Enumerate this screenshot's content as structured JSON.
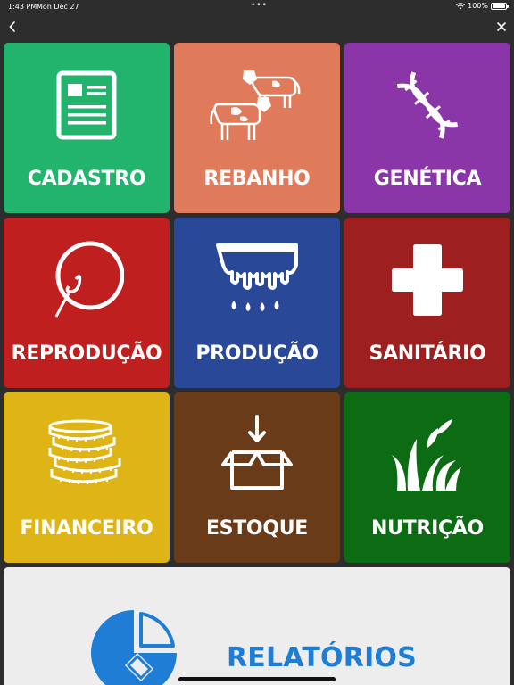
{
  "statusbar": {
    "time": "1:43 PM",
    "date": "Mon Dec 27",
    "dots": "•••",
    "battery": "100%"
  },
  "nav": {
    "back_icon": "chevron-left-icon",
    "close_icon": "close-icon"
  },
  "tiles": [
    {
      "label": "CADASTRO",
      "color": "#22b36c",
      "icon": "document-icon"
    },
    {
      "label": "REBANHO",
      "color": "#df7b5b",
      "icon": "cows-icon"
    },
    {
      "label": "GENÉTICA",
      "color": "#8a35a8",
      "icon": "dna-icon"
    },
    {
      "label": "REPRODUÇÃO",
      "color": "#c01f1f",
      "icon": "egg-sperm-icon"
    },
    {
      "label": "PRODUÇÃO",
      "color": "#2a4898",
      "icon": "milk-udder-icon"
    },
    {
      "label": "SANITÁRIO",
      "color": "#9e1f1f",
      "icon": "medical-cross-icon"
    },
    {
      "label": "FINANCEIRO",
      "color": "#dfb417",
      "icon": "coins-icon"
    },
    {
      "label": "ESTOQUE",
      "color": "#6a3b18",
      "icon": "box-arrow-icon"
    },
    {
      "label": "NUTRIÇÃO",
      "color": "#0d6b13",
      "icon": "grass-icon"
    }
  ],
  "report": {
    "label": "RELATÓRIOS",
    "color": "#1f7dd6",
    "icon": "pie-chart-icon"
  }
}
